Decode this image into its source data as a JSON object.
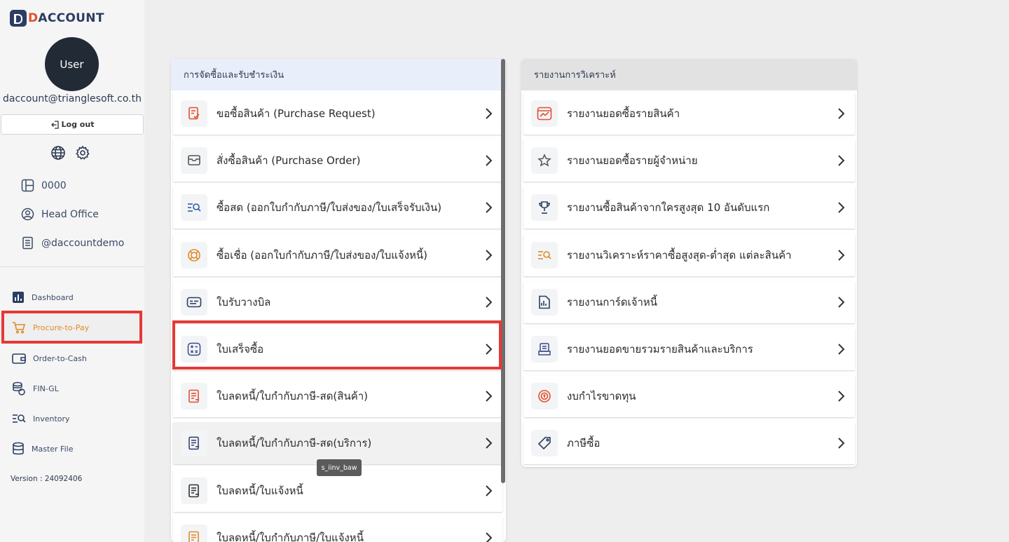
{
  "app": {
    "logo_prefix": "D",
    "logo_rest": "ACCOUNT",
    "avatar_label": "User",
    "email": "daccount@trianglesoft.co.th",
    "logout_label": "Log out",
    "version": "Version : 24092406",
    "accent_color": "#e08a2a",
    "brand_color": "#2b3d63"
  },
  "info": {
    "company_code": "0000",
    "branch": "Head Office",
    "database": "@daccountdemo"
  },
  "nav": [
    {
      "label": "Dashboard",
      "icon": "bar-chart-icon"
    },
    {
      "label": "Procure-to-Pay",
      "icon": "cart-icon",
      "active": true
    },
    {
      "label": "Order-to-Cash",
      "icon": "wallet-icon"
    },
    {
      "label": "FIN-GL",
      "icon": "coins-icon"
    },
    {
      "label": "Inventory",
      "icon": "list-search-icon"
    },
    {
      "label": "Master File",
      "icon": "database-icon"
    }
  ],
  "procure_panel": {
    "title": "การจัดซื้อและรับชำระเงิน",
    "items": [
      {
        "label": "ขอซื้อสินค้า (Purchase Request)",
        "icon": "request-doc-icon"
      },
      {
        "label": "สั่งซื้อสินค้า (Purchase Order)",
        "icon": "order-tray-icon"
      },
      {
        "label": "ซื้อสด (ออกใบกำกับภาษี/ใบส่งของ/ใบเสร็จรับเงิน)",
        "icon": "list-search-icon"
      },
      {
        "label": "ซื้อเชื่อ (ออกใบกำกับภาษี/ใบส่งของ/ใบแจ้งหนี้)",
        "icon": "credit-badge-icon"
      },
      {
        "label": "ใบรับวางบิล",
        "icon": "bill-card-icon"
      },
      {
        "label": "ใบเสร็จซื้อ",
        "icon": "calculator-icon"
      },
      {
        "label": "ใบลดหนี้/ใบกำกับภาษี-สด(สินค้า)",
        "icon": "credit-note-icon"
      },
      {
        "label": "ใบลดหนี้/ใบกำกับภาษี-สด(บริการ)",
        "icon": "service-note-icon"
      },
      {
        "label": "ใบลดหนี้/ใบแจ้งหนี้",
        "icon": "debit-note-icon"
      },
      {
        "label": "ใบลดหนี้/ใบกำกับภาษี/ใบแจ้งหนี้",
        "icon": "tax-note-icon"
      }
    ],
    "tooltip": "s_iinv_baw"
  },
  "report_panel": {
    "title": "รายงานการวิเคราะห์",
    "items": [
      {
        "label": "รายงานยอดซื้อรายสินค้า",
        "icon": "trend-chart-icon"
      },
      {
        "label": "รายงานยอดซื้อรายผู้จำหน่าย",
        "icon": "star-icon"
      },
      {
        "label": "รายงานซื้อสินค้าจากใครสูงสุด 10 อันดับแรก",
        "icon": "trophy-icon"
      },
      {
        "label": "รายงานวิเคราะห์ราคาซื้อสูงสุด-ต่ำสุด แต่ละสินค้า",
        "icon": "list-search-icon"
      },
      {
        "label": "รายงานการ์ดเจ้าหนี้",
        "icon": "report-doc-icon"
      },
      {
        "label": "รายงานยอดขายรวมรายสินค้าและบริการ",
        "icon": "sales-summary-icon"
      },
      {
        "label": "งบกำไรขาดทุน",
        "icon": "profit-loss-icon"
      },
      {
        "label": "ภาษีซื้อ",
        "icon": "tag-icon"
      }
    ]
  }
}
